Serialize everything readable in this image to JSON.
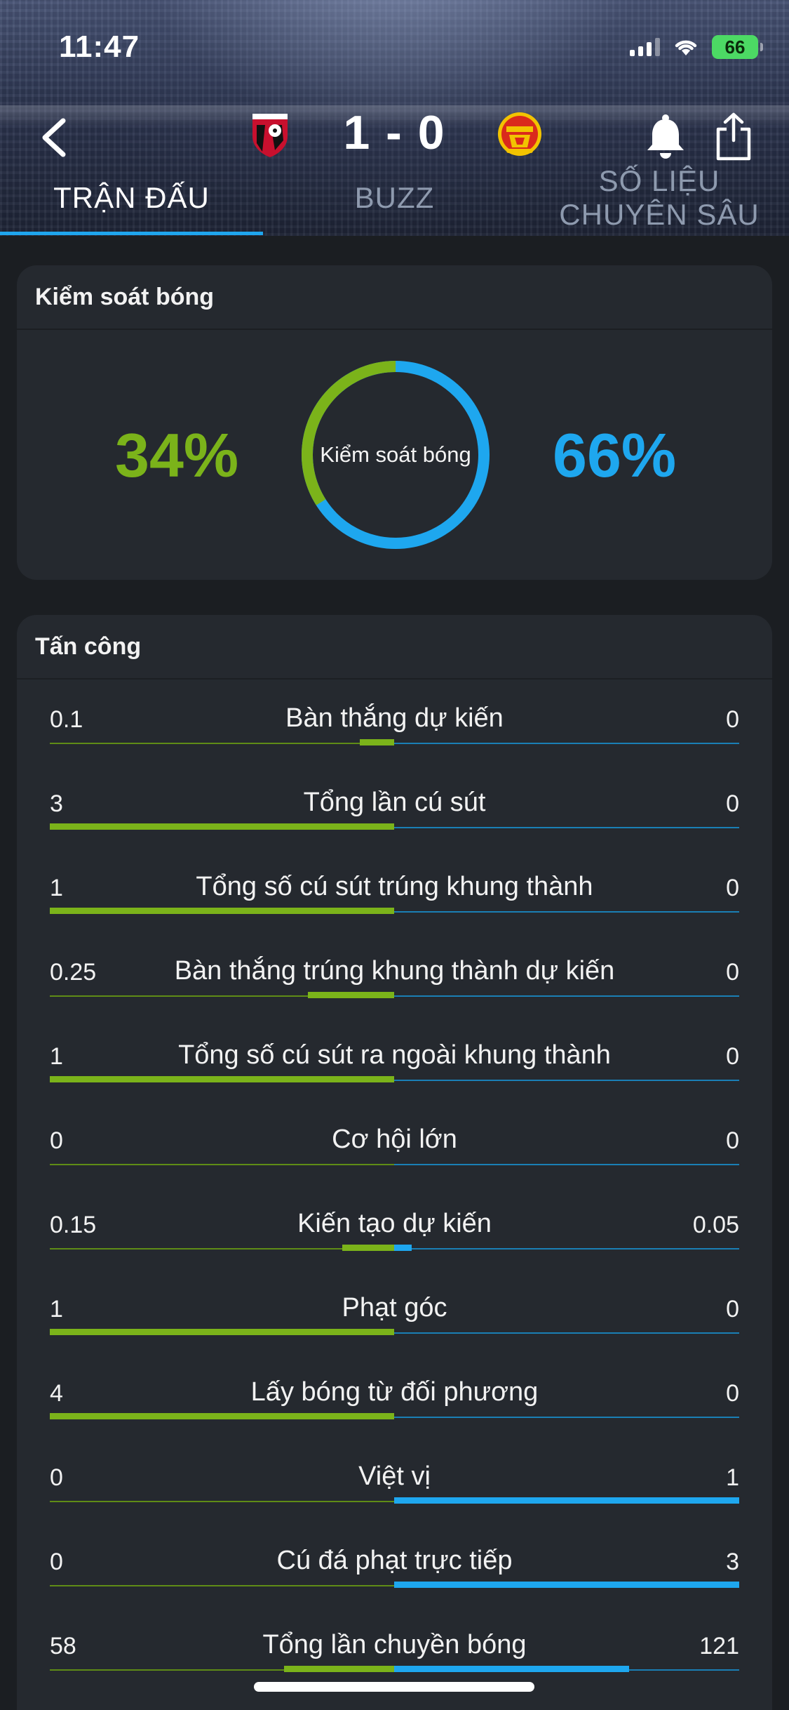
{
  "status_bar": {
    "time": "11:47",
    "battery": "66"
  },
  "match": {
    "score": "1 - 0",
    "home_team_icon": "bournemouth-crest-icon",
    "away_team_icon": "man-utd-crest-icon"
  },
  "tabs": [
    {
      "label": "TRẬN ĐẤU",
      "active": true
    },
    {
      "label": "BUZZ",
      "active": false
    },
    {
      "label": "SỐ LIỆU CHUYÊN SÂU",
      "active": false
    }
  ],
  "colors": {
    "home": "#7bb31a",
    "away": "#1ea7ef",
    "card": "#25292f",
    "background": "#1b1e22"
  },
  "possession": {
    "title": "Kiểm soát bóng",
    "center_label": "Kiểm soát bóng",
    "home_value": 34,
    "away_value": 66,
    "home_text": "34%",
    "away_text": "66%"
  },
  "attack": {
    "title": "Tấn công",
    "stats": [
      {
        "label": "Bàn thắng dự kiến",
        "home": "0.1",
        "away": "0",
        "home_fill": 0.1,
        "away_fill": 0
      },
      {
        "label": "Tổng lần cú sút",
        "home": "3",
        "away": "0",
        "home_fill": 1,
        "away_fill": 0
      },
      {
        "label": "Tổng số cú sút trúng khung thành",
        "home": "1",
        "away": "0",
        "home_fill": 1,
        "away_fill": 0
      },
      {
        "label": "Bàn thắng trúng khung thành dự kiến",
        "home": "0.25",
        "away": "0",
        "home_fill": 0.25,
        "away_fill": 0
      },
      {
        "label": "Tổng số cú sút ra ngoài khung thành",
        "home": "1",
        "away": "0",
        "home_fill": 1,
        "away_fill": 0
      },
      {
        "label": "Cơ hội lớn",
        "home": "0",
        "away": "0",
        "home_fill": 0,
        "away_fill": 0
      },
      {
        "label": "Kiến tạo dự kiến",
        "home": "0.15",
        "away": "0.05",
        "home_fill": 0.15,
        "away_fill": 0.05
      },
      {
        "label": "Phạt góc",
        "home": "1",
        "away": "0",
        "home_fill": 1,
        "away_fill": 0
      },
      {
        "label": "Lấy bóng từ đối phương",
        "home": "4",
        "away": "0",
        "home_fill": 1,
        "away_fill": 0
      },
      {
        "label": "Việt vị",
        "home": "0",
        "away": "1",
        "home_fill": 0,
        "away_fill": 1
      },
      {
        "label": "Cú đá phạt trực tiếp",
        "home": "0",
        "away": "3",
        "home_fill": 0,
        "away_fill": 1
      },
      {
        "label": "Tổng lần chuyền bóng",
        "home": "58",
        "away": "121",
        "home_fill": 0.32,
        "away_fill": 0.68
      }
    ]
  }
}
